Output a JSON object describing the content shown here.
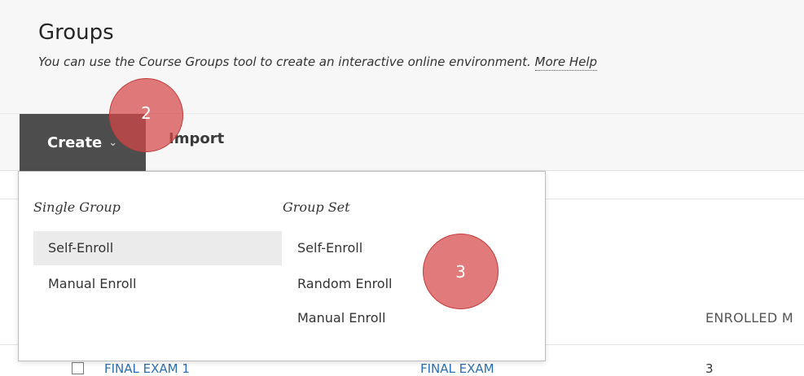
{
  "header": {
    "title": "Groups",
    "description": "You can use the Course Groups tool to create an interactive online environment.",
    "more_help": "More Help"
  },
  "toolbar": {
    "create_label": "Create",
    "import_label": "Import"
  },
  "create_menu": {
    "single_group": {
      "heading": "Single Group",
      "items": [
        "Self-Enroll",
        "Manual Enroll"
      ]
    },
    "group_set": {
      "heading": "Group Set",
      "items": [
        "Self-Enroll",
        "Random Enroll",
        "Manual Enroll"
      ]
    }
  },
  "table": {
    "column_partial": "ENROLLED M",
    "row_name_partial": "FINAL EXAM 1",
    "row_set_partial": "FINAL EXAM",
    "row_count_partial": "3"
  },
  "annotations": {
    "marker_2": "2",
    "marker_3": "3"
  },
  "colors": {
    "create_button": "#4d4d4d",
    "marker": "#d64848",
    "header_bg": "#f7f7f7"
  },
  "icons": {
    "create_dropdown": "chevron-down-icon"
  }
}
